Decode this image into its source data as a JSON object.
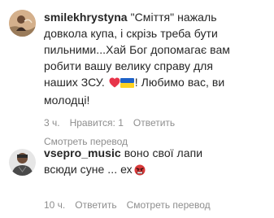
{
  "comments": [
    {
      "username": "smilekhrystyna",
      "avatar_icon": "user-avatar-icon",
      "text_lines": [
        "\"Сміття\" нажаль",
        "довкола купа, і скрізь треба бути",
        "пильними...Хай Бог допомагає вам",
        "робити вашу велику справу для",
        "наших ЗСУ.",
        "! Любимо вас, ви",
        "молодці!"
      ],
      "emojis": [
        "red-heart-emoji",
        "ukraine-flag-emoji"
      ],
      "time": "3 ч.",
      "likes": "Нравится: 1",
      "reply": "Ответить",
      "translate": "Смотреть перевод"
    },
    {
      "username": "vsepro_music",
      "avatar_icon": "user-avatar-icon",
      "text_lines": [
        "воно свої лапи",
        "всюди суне ... ех"
      ],
      "emojis": [
        "angry-face-emoji"
      ],
      "time": "10 ч.",
      "reply": "Ответить",
      "translate": "Смотреть перевод"
    }
  ],
  "colors": {
    "text": "#262626",
    "secondary": "#8e8e8e",
    "background": "#ffffff",
    "heart": "#ed4956"
  }
}
